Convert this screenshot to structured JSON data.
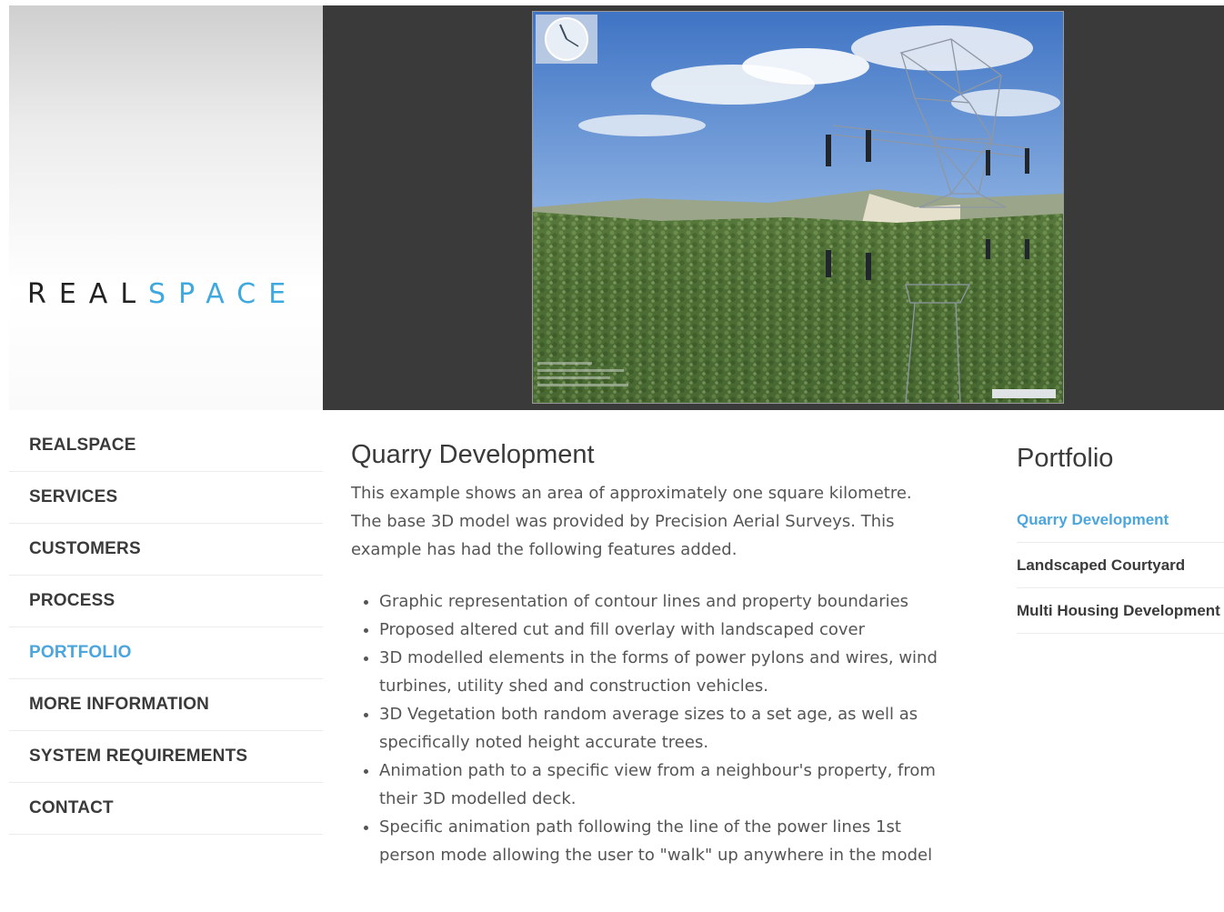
{
  "header": {
    "logo_part1": "REAL",
    "logo_part2": "SPACE"
  },
  "nav": {
    "items": [
      {
        "label": "REALSPACE",
        "active": false
      },
      {
        "label": "SERVICES",
        "active": false
      },
      {
        "label": "CUSTOMERS",
        "active": false
      },
      {
        "label": "PROCESS",
        "active": false
      },
      {
        "label": "PORTFOLIO",
        "active": true
      },
      {
        "label": "MORE INFORMATION",
        "active": false
      },
      {
        "label": "SYSTEM REQUIREMENTS",
        "active": false
      },
      {
        "label": "CONTACT",
        "active": false
      }
    ]
  },
  "main": {
    "title": "Quarry Development",
    "intro": "This example shows an area of approximately one square kilometre. The base 3D model was provided by Precision Aerial Surveys. This example has had the following features added.",
    "features": [
      "Graphic representation of contour lines and property boundaries",
      "Proposed altered cut and fill overlay with landscaped cover",
      "3D modelled elements in the forms of power pylons and wires, wind turbines, utility shed and construction vehicles.",
      "3D Vegetation both random average sizes to a set age, as well as specifically noted height accurate trees.",
      "Animation path to a specific view from a neighbour's property, from their 3D modelled deck.",
      "Specific animation path following the line of the power lines 1st person mode allowing the user to \"walk\" up anywhere in the model"
    ]
  },
  "sidebar": {
    "title": "Portfolio",
    "items": [
      {
        "label": "Quarry Development",
        "active": true
      },
      {
        "label": "Landscaped Courtyard",
        "active": false
      },
      {
        "label": "Multi Housing Development",
        "active": false
      }
    ]
  },
  "colors": {
    "accent": "#4aa6dc",
    "text_dark": "#3a3a3a",
    "hero_bg": "#3a3a3a"
  },
  "icons": {
    "compass": "compass-icon"
  }
}
